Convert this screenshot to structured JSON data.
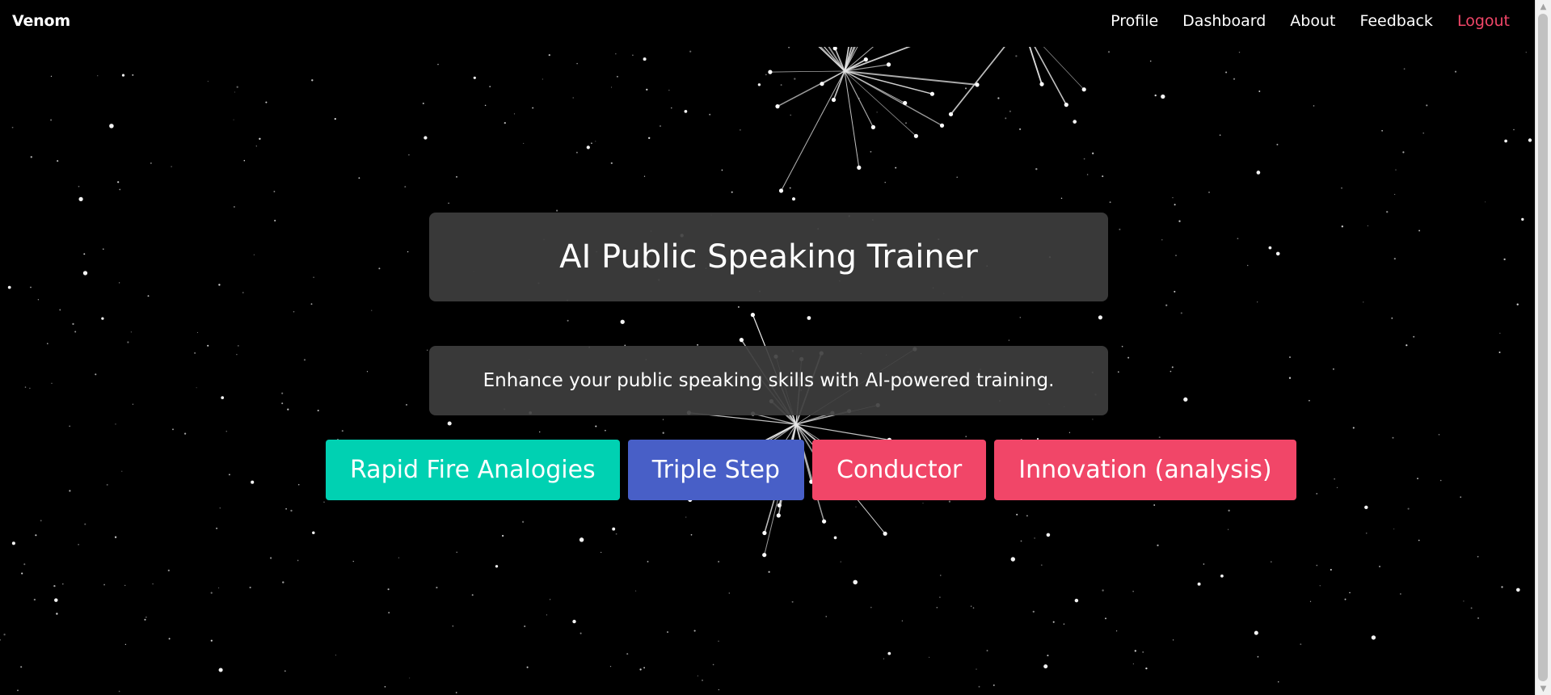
{
  "navbar": {
    "brand": "Venom",
    "links": [
      {
        "label": "Profile"
      },
      {
        "label": "Dashboard"
      },
      {
        "label": "About"
      },
      {
        "label": "Feedback"
      },
      {
        "label": "Logout"
      }
    ]
  },
  "hero": {
    "title": "AI Public Speaking Trainer",
    "subtitle": "Enhance your public speaking skills with AI-powered training."
  },
  "actions": {
    "buttons": [
      {
        "label": "Rapid Fire Analogies",
        "color": "#00d1b2"
      },
      {
        "label": "Triple Step",
        "color": "#485fc7"
      },
      {
        "label": "Conductor",
        "color": "#f14668"
      },
      {
        "label": "Innovation (analysis)",
        "color": "#f14668"
      }
    ]
  },
  "colors": {
    "background": "#000000",
    "card": "#3e3e3e",
    "logout": "#f14668",
    "scrollbar_track": "#f1f1f1",
    "scrollbar_thumb": "#c1c1c1"
  },
  "icons": {
    "scroll_up": "triangle-up",
    "scroll_down": "triangle-down"
  }
}
